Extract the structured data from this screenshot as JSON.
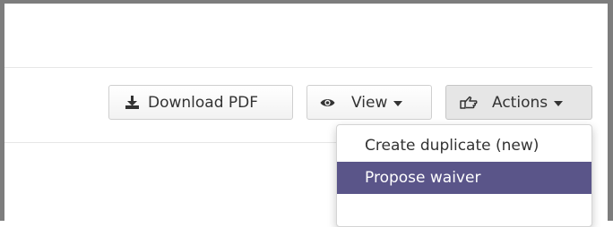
{
  "toolbar": {
    "download_pdf_label": "Download PDF",
    "view_label": "View",
    "actions_label": "Actions"
  },
  "actions_menu": {
    "items": [
      {
        "label": "Create duplicate (new)",
        "selected": false
      },
      {
        "label": "Propose waiver",
        "selected": true
      }
    ]
  },
  "icons": {
    "download": "download-icon",
    "view": "eye-icon",
    "actions": "hand-pointer-icon"
  },
  "colors": {
    "highlight": "#5a5589",
    "frame": "#7d7d7d",
    "text": "#333333"
  }
}
